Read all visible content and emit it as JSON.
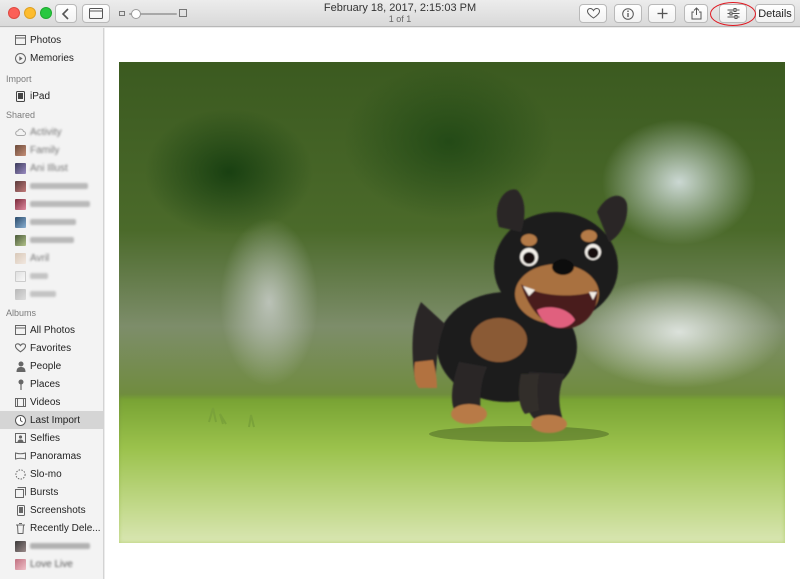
{
  "window": {
    "title": "February 18, 2017, 2:15:03 PM",
    "subtitle": "1 of 1"
  },
  "toolbar": {
    "back_icon": "chevron-left-icon",
    "sidebar_toggle_icon": "sidebar-icon",
    "favorite_icon": "heart-icon",
    "info_icon": "info-icon",
    "add_icon": "plus-icon",
    "share_icon": "share-icon",
    "edit_icon": "sliders-icon",
    "details_label": "Details",
    "annotation_color": "#e0161f"
  },
  "sidebar": {
    "library": [
      {
        "label": "Photos",
        "icon": "photos-icon"
      },
      {
        "label": "Memories",
        "icon": "memories-icon"
      }
    ],
    "import_header": "Import",
    "import": [
      {
        "label": "iPad",
        "icon": "ipad-icon"
      }
    ],
    "shared_header": "Shared",
    "shared": [
      {
        "label": "Activity",
        "icon": "cloud-icon"
      },
      {
        "label": "Family",
        "icon": "album-thumbnail-icon"
      },
      {
        "label": "Ani Illust",
        "icon": "album-thumbnail-icon"
      },
      {
        "label": "",
        "icon": "album-thumbnail-icon"
      },
      {
        "label": "",
        "icon": "album-thumbnail-icon"
      },
      {
        "label": "",
        "icon": "album-thumbnail-icon"
      },
      {
        "label": "",
        "icon": "album-thumbnail-icon"
      },
      {
        "label": "Avril",
        "icon": "album-thumbnail-icon"
      },
      {
        "label": "",
        "icon": "album-thumbnail-icon"
      },
      {
        "label": "",
        "icon": "album-thumbnail-icon"
      }
    ],
    "albums_header": "Albums",
    "albums": [
      {
        "label": "All Photos",
        "icon": "photos-icon"
      },
      {
        "label": "Favorites",
        "icon": "heart-icon"
      },
      {
        "label": "People",
        "icon": "person-icon"
      },
      {
        "label": "Places",
        "icon": "pin-icon"
      },
      {
        "label": "Videos",
        "icon": "video-icon"
      },
      {
        "label": "Last Import",
        "icon": "clock-icon",
        "selected": true
      },
      {
        "label": "Selfies",
        "icon": "selfie-icon"
      },
      {
        "label": "Panoramas",
        "icon": "panorama-icon"
      },
      {
        "label": "Slo-mo",
        "icon": "slomo-icon"
      },
      {
        "label": "Bursts",
        "icon": "burst-icon"
      },
      {
        "label": "Screenshots",
        "icon": "screenshot-icon"
      },
      {
        "label": "Recently Dele...",
        "icon": "trash-icon"
      },
      {
        "label": "",
        "icon": "album-thumbnail-icon"
      },
      {
        "label": "Love Live",
        "icon": "album-thumbnail-icon"
      }
    ]
  },
  "photo": {
    "subject": "dog-photo"
  }
}
